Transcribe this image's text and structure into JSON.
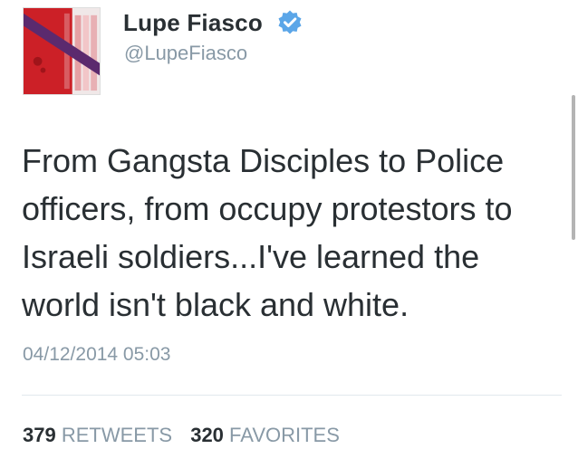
{
  "author": {
    "name": "Lupe Fiasco",
    "handle": "@LupeFiasco",
    "verified_icon": "verified-badge-icon",
    "verified_color": "#5ba6e8"
  },
  "tweet": {
    "text": "From Gangsta Disciples to Police officers, from occupy protestors to Israeli soldiers...I've learned the world isn't black and white.",
    "timestamp": "04/12/2014 05:03"
  },
  "stats": {
    "retweets_count": "379",
    "retweets_label": "RETWEETS",
    "favorites_count": "320",
    "favorites_label": "FAVORITES"
  },
  "colors": {
    "text": "#292f33",
    "muted": "#8899a6",
    "divider": "#e1e8ed"
  }
}
